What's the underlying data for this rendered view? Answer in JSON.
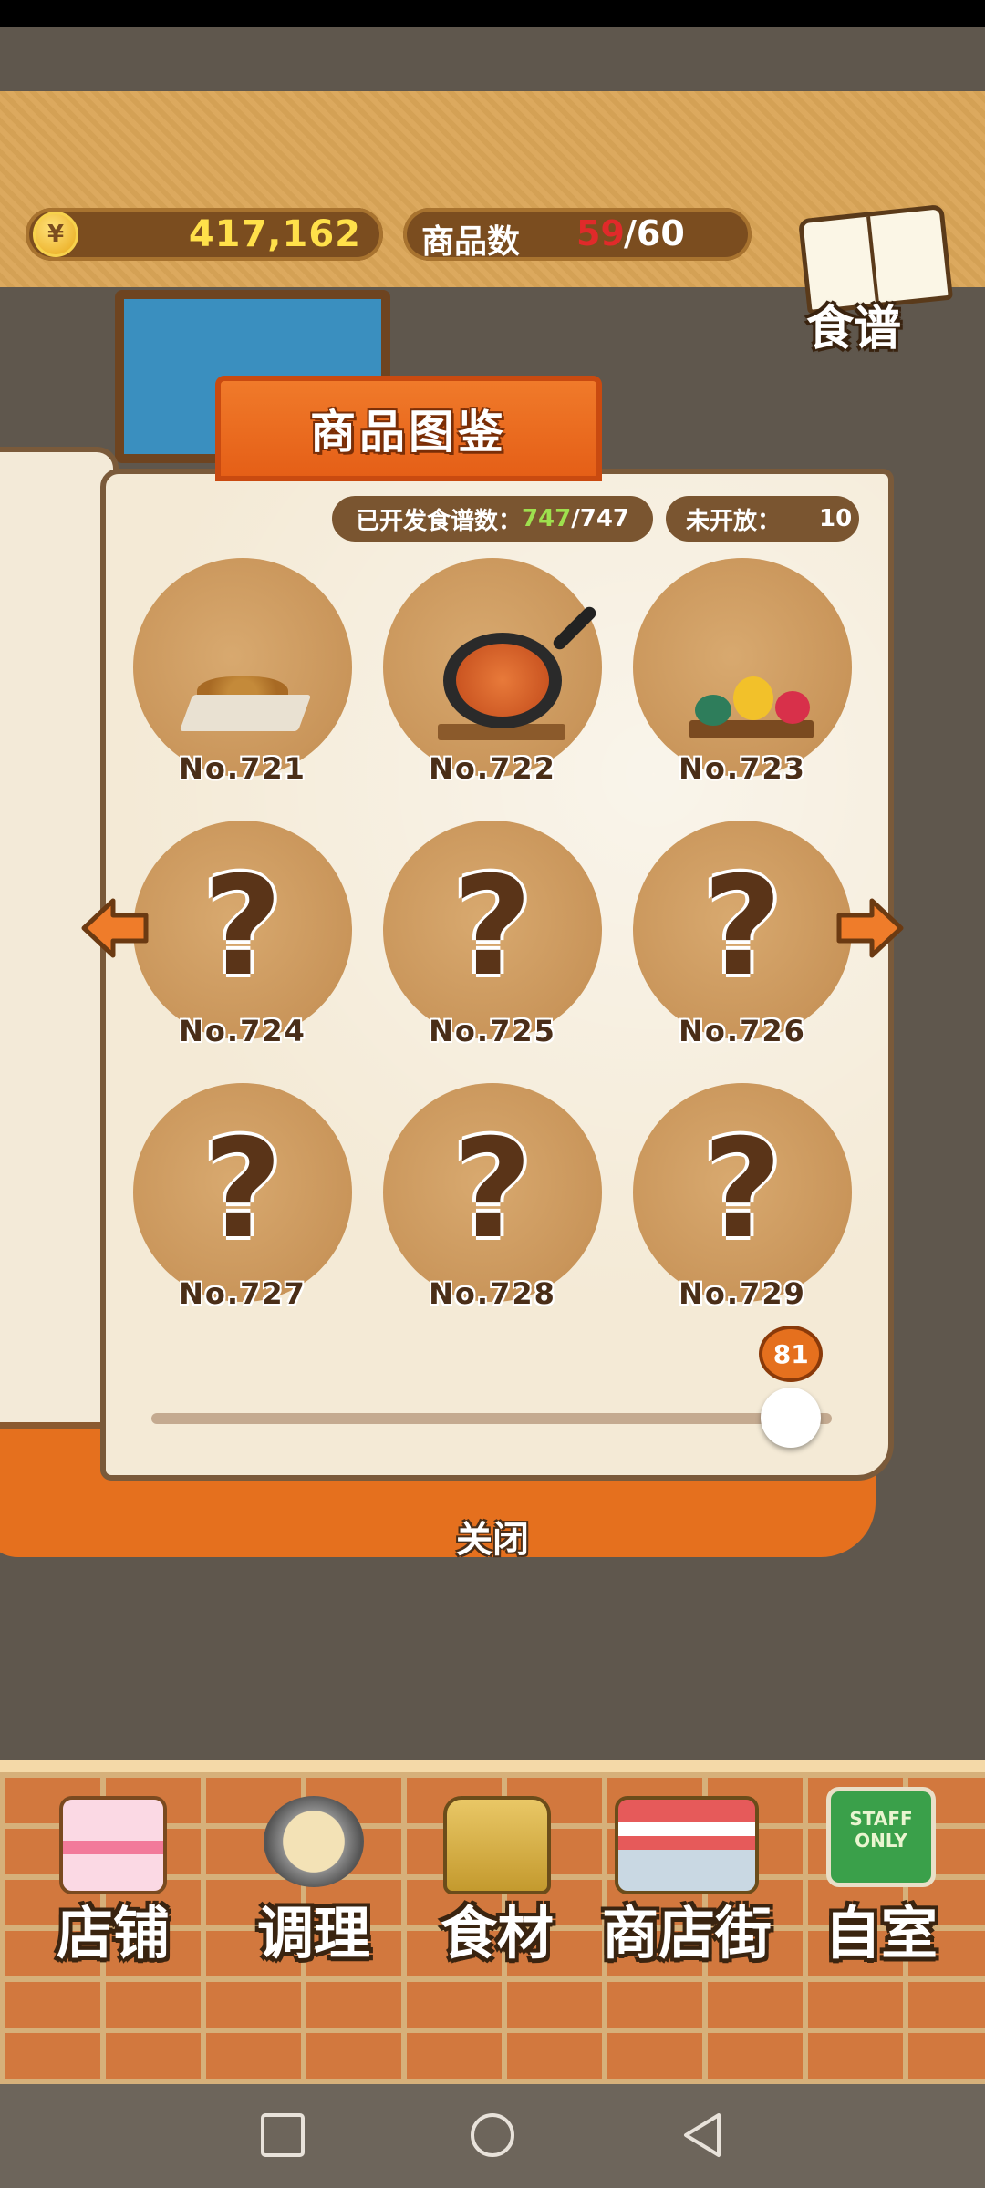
{
  "header": {
    "currency_icon": "¥",
    "money": "417,162",
    "goods_label": "商品数",
    "goods_count": "59",
    "goods_max": "/60",
    "recipe_label": "食谱"
  },
  "dialog": {
    "title": "商品图鉴",
    "developed_label": "已开发食谱数：",
    "developed_current": "747",
    "developed_total": "/747",
    "unopened_label": "未开放：",
    "unopened_value": "10",
    "items": [
      {
        "number": "No.721",
        "unlocked": true
      },
      {
        "number": "No.722",
        "unlocked": true
      },
      {
        "number": "No.723",
        "unlocked": true
      },
      {
        "number": "No.724",
        "unlocked": false,
        "mark": "?"
      },
      {
        "number": "No.725",
        "unlocked": false,
        "mark": "?"
      },
      {
        "number": "No.726",
        "unlocked": false,
        "mark": "?"
      },
      {
        "number": "No.727",
        "unlocked": false,
        "mark": "?"
      },
      {
        "number": "No.728",
        "unlocked": false,
        "mark": "?"
      },
      {
        "number": "No.729",
        "unlocked": false,
        "mark": "?"
      }
    ],
    "page_slider": {
      "value": "81",
      "fraction": 0.94
    },
    "close_label": "关闭"
  },
  "bottom_nav": {
    "items": [
      {
        "label": "店铺",
        "icon": "cake-icon"
      },
      {
        "label": "调理",
        "icon": "mixing-bowl-icon"
      },
      {
        "label": "食材",
        "icon": "ingredient-bag-icon"
      },
      {
        "label": "商店街",
        "icon": "shop-street-icon"
      },
      {
        "label": "自室",
        "icon": "staff-only-sign-icon",
        "sign_text": "STAFF ONLY"
      }
    ]
  },
  "colors": {
    "accent_orange": "#e5701e",
    "money_yellow": "#ffe04a",
    "count_red": "#e02a2a",
    "developed_green": "#9ee04e"
  }
}
